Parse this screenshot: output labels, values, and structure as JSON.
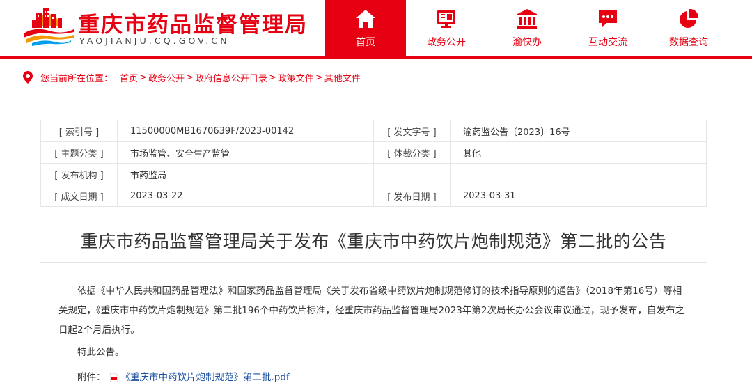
{
  "header": {
    "site_title": "重庆市药品监督管理局",
    "site_domain": "YAOJIANJU.CQ.GOV.CN",
    "accent": "#e60012",
    "nav": [
      {
        "label": "首页",
        "icon": "home-icon",
        "active": true
      },
      {
        "label": "政务公开",
        "icon": "monitor-icon",
        "active": false
      },
      {
        "label": "渝快办",
        "icon": "government-building-icon",
        "active": false
      },
      {
        "label": "互动交流",
        "icon": "chat-icon",
        "active": false
      },
      {
        "label": "数据查询",
        "icon": "pie-chart-icon",
        "active": false
      }
    ]
  },
  "breadcrumb": {
    "prefix": "您当前所在位置：",
    "items": [
      "首页",
      "政务公开",
      "政府信息公开目录",
      "政策文件",
      "其他文件"
    ],
    "separator": ">"
  },
  "info": {
    "index_label": "[ 索引号 ]",
    "index_value": "11500000MB1670639F/2023-00142",
    "doc_no_label": "[ 发文字号 ]",
    "doc_no_value": "渝药监公告〔2023〕16号",
    "topic_label": "[ 主题分类 ]",
    "topic_value": "市场监管、安全生产监管",
    "genre_label": "[ 体裁分类 ]",
    "genre_value": "其他",
    "org_label": "[ 发布机构 ]",
    "org_value": "市药监局",
    "created_label": "[ 成文日期 ]",
    "created_value": "2023-03-22",
    "published_label": "[ 发布日期 ]",
    "published_value": "2023-03-31"
  },
  "article": {
    "title": "重庆市药品监督管理局关于发布《重庆市中药饮片炮制规范》第二批的公告",
    "paragraph1": "依据《中华人民共和国药品管理法》和国家药品监督管理局《关于发布省级中药饮片炮制规范修订的技术指导原则的通告》（2018年第16号）等相关规定，《重庆市中药饮片炮制规范》第二批196个中药饮片标准，经重庆市药品监督管理局2023年第2次局长办公会议审议通过，现予发布，自发布之日起2个月后执行。",
    "paragraph2": "特此公告。",
    "attachment_label": "附件：",
    "attachment_name": "《重庆市中药饮片炮制规范》第二批.pdf"
  }
}
